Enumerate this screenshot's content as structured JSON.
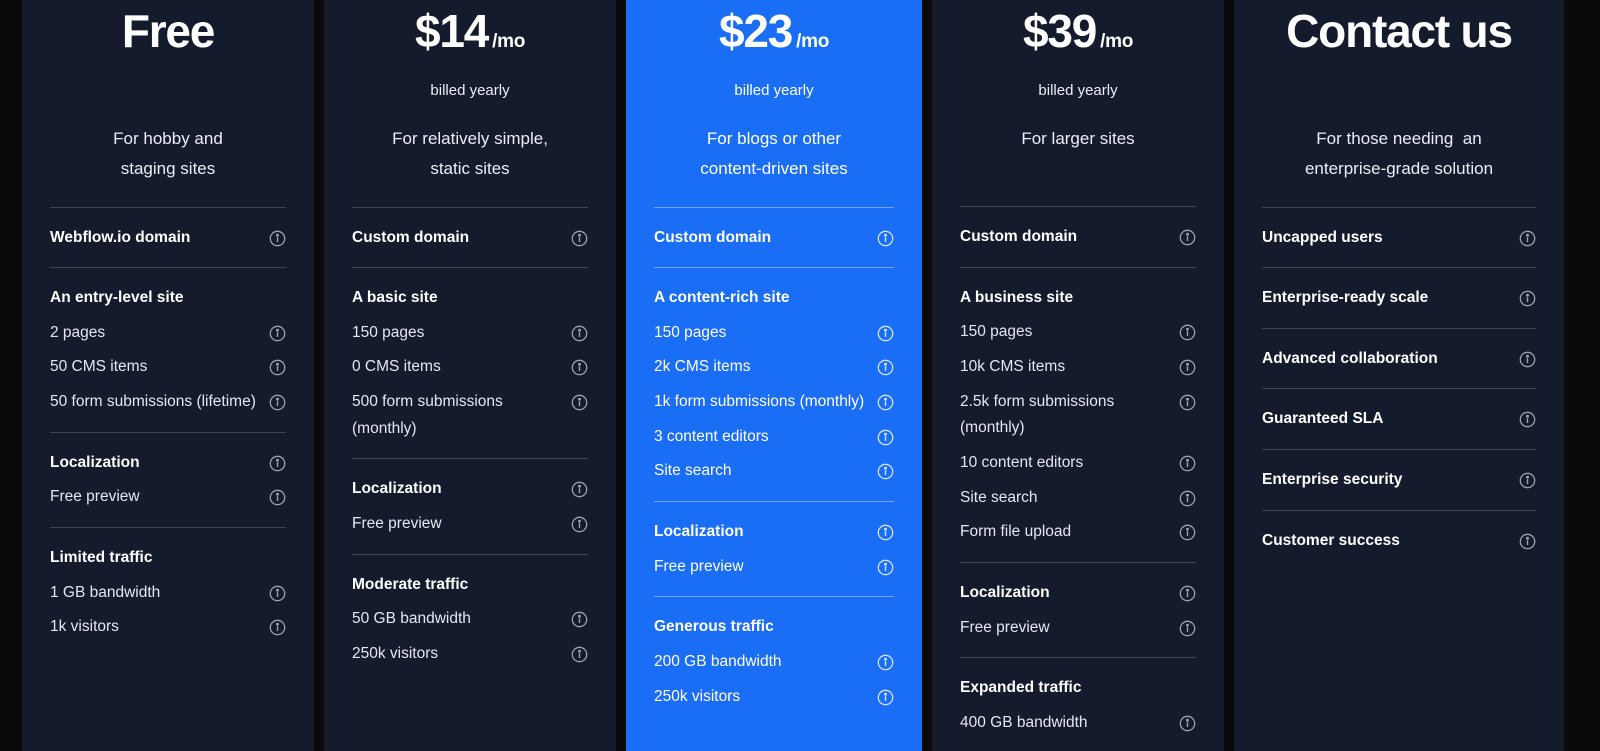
{
  "theme": {
    "page_background": "#0a0a0c",
    "card_background": "#141b2c",
    "featured_background": "#1a6df5",
    "text_primary": "#ffffff",
    "text_secondary": "#e2e7f0",
    "divider": "rgba(255,255,255,0.18)",
    "info_icon_color": "#9aa3b4"
  },
  "icons": {
    "info": "info-circle-icon"
  },
  "plans": [
    {
      "id": "free",
      "featured": false,
      "title": "Free",
      "price_amount": "Free",
      "price_period": "",
      "billing_note": "",
      "description": "For hobby and\nstaging sites",
      "groups": [
        {
          "heading": null,
          "items": [
            {
              "label": "Webflow.io domain",
              "bold": true,
              "info": true
            }
          ]
        },
        {
          "heading": "An entry-level site",
          "items": [
            {
              "label": "An entry-level site",
              "bold": true,
              "info": false
            },
            {
              "label": "2 pages",
              "bold": false,
              "info": true
            },
            {
              "label": "50 CMS items",
              "bold": false,
              "info": true
            },
            {
              "label": "50 form submissions (lifetime)",
              "bold": false,
              "info": true
            }
          ]
        },
        {
          "heading": "Localization",
          "items": [
            {
              "label": "Localization",
              "bold": true,
              "info": true
            },
            {
              "label": "Free preview",
              "bold": false,
              "info": true
            }
          ]
        },
        {
          "heading": "Limited traffic",
          "items": [
            {
              "label": "Limited traffic",
              "bold": true,
              "info": false
            },
            {
              "label": "1 GB bandwidth",
              "bold": false,
              "info": true
            },
            {
              "label": "1k visitors",
              "bold": false,
              "info": true
            }
          ]
        }
      ]
    },
    {
      "id": "basic",
      "featured": false,
      "title": "$14 /mo",
      "price_amount": "$14",
      "price_period": "/mo",
      "billing_note": "billed yearly",
      "description": "For relatively simple,\nstatic sites",
      "groups": [
        {
          "heading": null,
          "items": [
            {
              "label": "Custom domain",
              "bold": true,
              "info": true
            }
          ]
        },
        {
          "heading": "A basic site",
          "items": [
            {
              "label": "A basic site",
              "bold": true,
              "info": false
            },
            {
              "label": "150 pages",
              "bold": false,
              "info": true
            },
            {
              "label": "0 CMS items",
              "bold": false,
              "info": true
            },
            {
              "label": "500 form submissions (monthly)",
              "bold": false,
              "info": true
            }
          ]
        },
        {
          "heading": "Localization",
          "items": [
            {
              "label": "Localization",
              "bold": true,
              "info": true
            },
            {
              "label": "Free preview",
              "bold": false,
              "info": true
            }
          ]
        },
        {
          "heading": "Moderate traffic",
          "items": [
            {
              "label": "Moderate traffic",
              "bold": true,
              "info": false
            },
            {
              "label": "50 GB bandwidth",
              "bold": false,
              "info": true
            },
            {
              "label": "250k visitors",
              "bold": false,
              "info": true
            }
          ]
        }
      ]
    },
    {
      "id": "cms",
      "featured": true,
      "title": "$23 /mo",
      "price_amount": "$23",
      "price_period": "/mo",
      "billing_note": "billed yearly",
      "description": "For blogs or other\ncontent-driven sites",
      "groups": [
        {
          "heading": null,
          "items": [
            {
              "label": "Custom domain",
              "bold": true,
              "info": true
            }
          ]
        },
        {
          "heading": "A content-rich site",
          "items": [
            {
              "label": "A content-rich site",
              "bold": true,
              "info": false
            },
            {
              "label": "150 pages",
              "bold": false,
              "info": true
            },
            {
              "label": "2k CMS items",
              "bold": false,
              "info": true
            },
            {
              "label": "1k form submissions (monthly)",
              "bold": false,
              "info": true
            },
            {
              "label": "3 content editors",
              "bold": false,
              "info": true
            },
            {
              "label": "Site search",
              "bold": false,
              "info": true
            }
          ]
        },
        {
          "heading": "Localization",
          "items": [
            {
              "label": "Localization",
              "bold": true,
              "info": true
            },
            {
              "label": "Free preview",
              "bold": false,
              "info": true
            }
          ]
        },
        {
          "heading": "Generous traffic",
          "items": [
            {
              "label": "Generous traffic",
              "bold": true,
              "info": false
            },
            {
              "label": "200 GB bandwidth",
              "bold": false,
              "info": true
            },
            {
              "label": "250k visitors",
              "bold": false,
              "info": true
            }
          ]
        }
      ]
    },
    {
      "id": "business",
      "featured": false,
      "title": "$39 /mo",
      "price_amount": "$39",
      "price_period": "/mo",
      "billing_note": "billed yearly",
      "description": "For larger sites",
      "groups": [
        {
          "heading": null,
          "items": [
            {
              "label": "Custom domain",
              "bold": true,
              "info": true
            }
          ]
        },
        {
          "heading": "A business site",
          "items": [
            {
              "label": "A business site",
              "bold": true,
              "info": false
            },
            {
              "label": "150 pages",
              "bold": false,
              "info": true
            },
            {
              "label": "10k CMS items",
              "bold": false,
              "info": true
            },
            {
              "label": "2.5k form submissions (monthly)",
              "bold": false,
              "info": true
            },
            {
              "label": "10 content editors",
              "bold": false,
              "info": true
            },
            {
              "label": "Site search",
              "bold": false,
              "info": true
            },
            {
              "label": "Form file upload",
              "bold": false,
              "info": true
            }
          ]
        },
        {
          "heading": "Localization",
          "items": [
            {
              "label": "Localization",
              "bold": true,
              "info": true
            },
            {
              "label": "Free preview",
              "bold": false,
              "info": true
            }
          ]
        },
        {
          "heading": "Expanded traffic",
          "items": [
            {
              "label": "Expanded traffic",
              "bold": true,
              "info": false
            },
            {
              "label": "400 GB bandwidth",
              "bold": false,
              "info": true
            }
          ]
        }
      ]
    },
    {
      "id": "enterprise",
      "featured": false,
      "title": "Contact us",
      "price_amount": "Contact us",
      "price_period": "",
      "billing_note": "",
      "description": "For those needing  an\nenterprise-grade solution",
      "groups": [
        {
          "heading": null,
          "items": [
            {
              "label": "Uncapped users",
              "bold": true,
              "info": true
            }
          ]
        },
        {
          "heading": null,
          "items": [
            {
              "label": "Enterprise-ready scale",
              "bold": true,
              "info": true
            }
          ]
        },
        {
          "heading": null,
          "items": [
            {
              "label": "Advanced collaboration",
              "bold": true,
              "info": true
            }
          ]
        },
        {
          "heading": null,
          "items": [
            {
              "label": "Guaranteed SLA",
              "bold": true,
              "info": true
            }
          ]
        },
        {
          "heading": null,
          "items": [
            {
              "label": "Enterprise security",
              "bold": true,
              "info": true
            }
          ]
        },
        {
          "heading": null,
          "items": [
            {
              "label": "Customer success",
              "bold": true,
              "info": true
            }
          ]
        }
      ]
    }
  ]
}
